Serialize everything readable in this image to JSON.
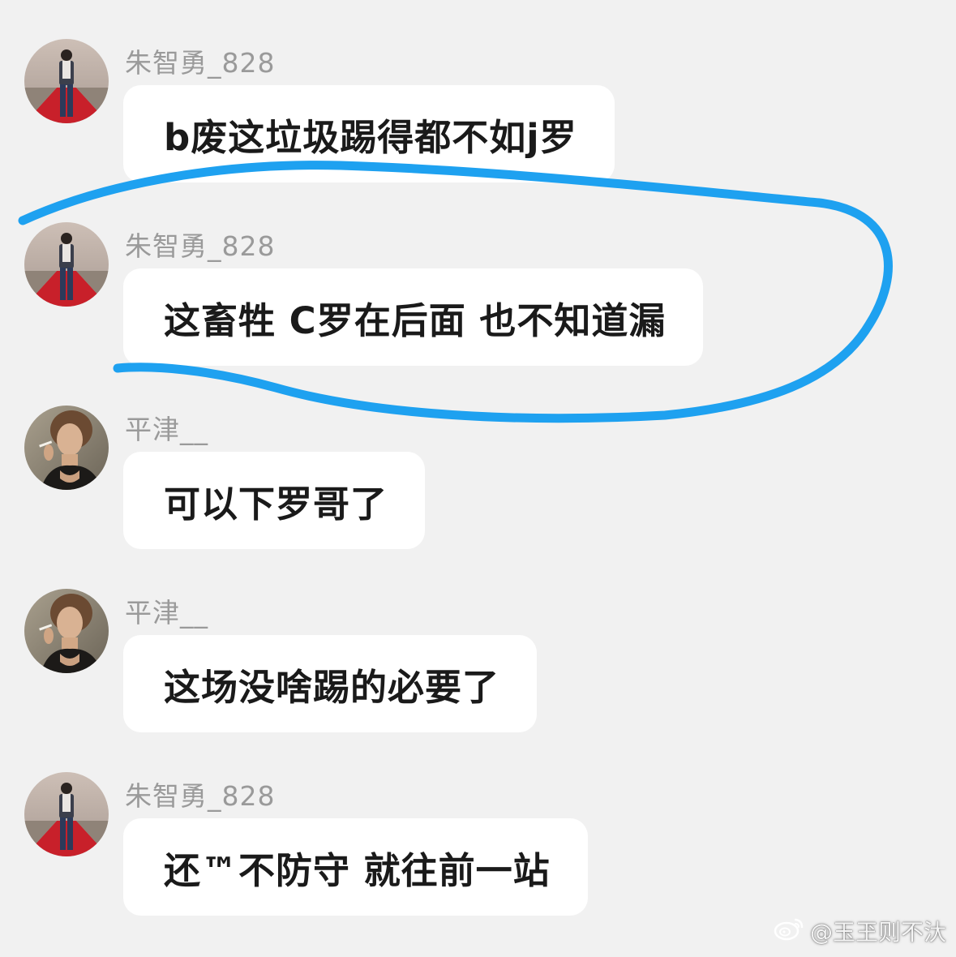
{
  "messages": [
    {
      "user": "朱智勇_828",
      "avatar": "red-carpet-man-avatar",
      "text": "b废这垃圾踢得都不如j罗"
    },
    {
      "user": "朱智勇_828",
      "avatar": "red-carpet-man-avatar",
      "text": "这畜牲 C罗在后面 也不知道漏"
    },
    {
      "user": "平津__",
      "avatar": "woman-smoking-avatar",
      "text": "可以下罗哥了"
    },
    {
      "user": "平津__",
      "avatar": "woman-smoking-avatar",
      "text": "这场没啥踢的必要了"
    },
    {
      "user": "朱智勇_828",
      "avatar": "red-carpet-man-avatar",
      "text": "还™不防守 就往前一站"
    }
  ],
  "watermark": {
    "icon": "weibo-icon",
    "handle": "@玉玊则不汏"
  },
  "colors": {
    "background": "#f1f1f1",
    "bubble": "#ffffff",
    "username": "#9a9a9a",
    "highlight": "#1ea1f0"
  }
}
